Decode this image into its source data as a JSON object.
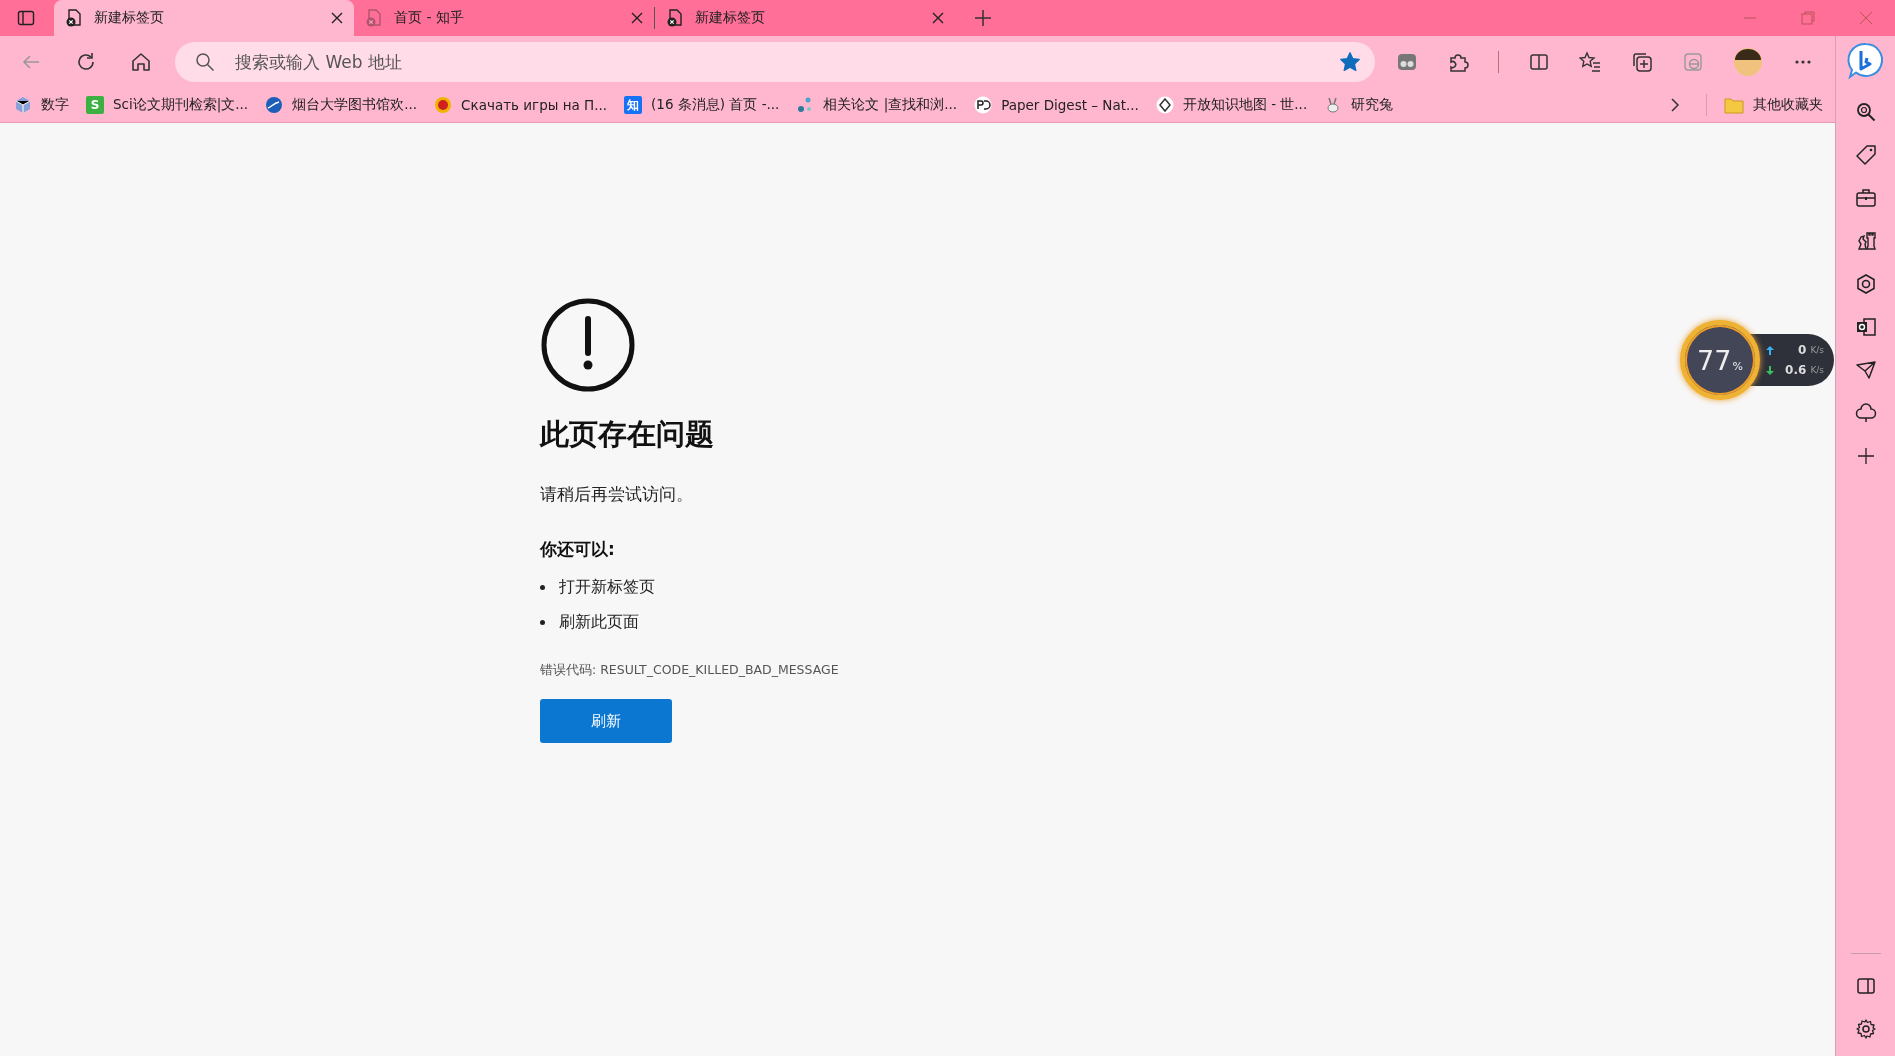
{
  "tabs": [
    {
      "title": "新建标签页",
      "selected": true,
      "kind": "page-error"
    },
    {
      "title": "首页 - 知乎",
      "selected": false,
      "kind": "page-faded"
    },
    {
      "title": "新建标签页",
      "selected": false,
      "kind": "page-error"
    }
  ],
  "address": {
    "placeholder": "搜索或输入 Web 地址",
    "favorite": true
  },
  "bookmarks": [
    {
      "label": "数字",
      "kind": "cube"
    },
    {
      "label": "Sci论文期刊检索|文...",
      "kind": "letter",
      "icon_text": "S",
      "color": "#3cb043"
    },
    {
      "label": "烟台大学图书馆欢...",
      "kind": "globe"
    },
    {
      "label": "Скачать игры на П...",
      "kind": "emblem"
    },
    {
      "label": "(16 条消息) 首页 -...",
      "kind": "letter",
      "icon_text": "知",
      "color": "#1772f6"
    },
    {
      "label": "相关论文 |查找和浏...",
      "kind": "dots"
    },
    {
      "label": "Paper Digest – Nat...",
      "kind": "pd"
    },
    {
      "label": "开放知识地图 - 世...",
      "kind": "diamond"
    },
    {
      "label": "研究兔",
      "kind": "rabbit"
    }
  ],
  "other_favorites": "其他收藏夹",
  "error": {
    "title": "此页存在问题",
    "message": "请稍后再尝试访问。",
    "suggest_heading": "你还可以:",
    "suggestions": [
      "打开新标签页",
      "刷新此页面"
    ],
    "code": "错误代码: RESULT_CODE_KILLED_BAD_MESSAGE",
    "button": "刷新"
  },
  "speed_widget": {
    "percent": "77",
    "percent_unit": "%",
    "upload": "0",
    "upload_unit": "K/s",
    "download": "0.6",
    "download_unit": "K/s"
  }
}
